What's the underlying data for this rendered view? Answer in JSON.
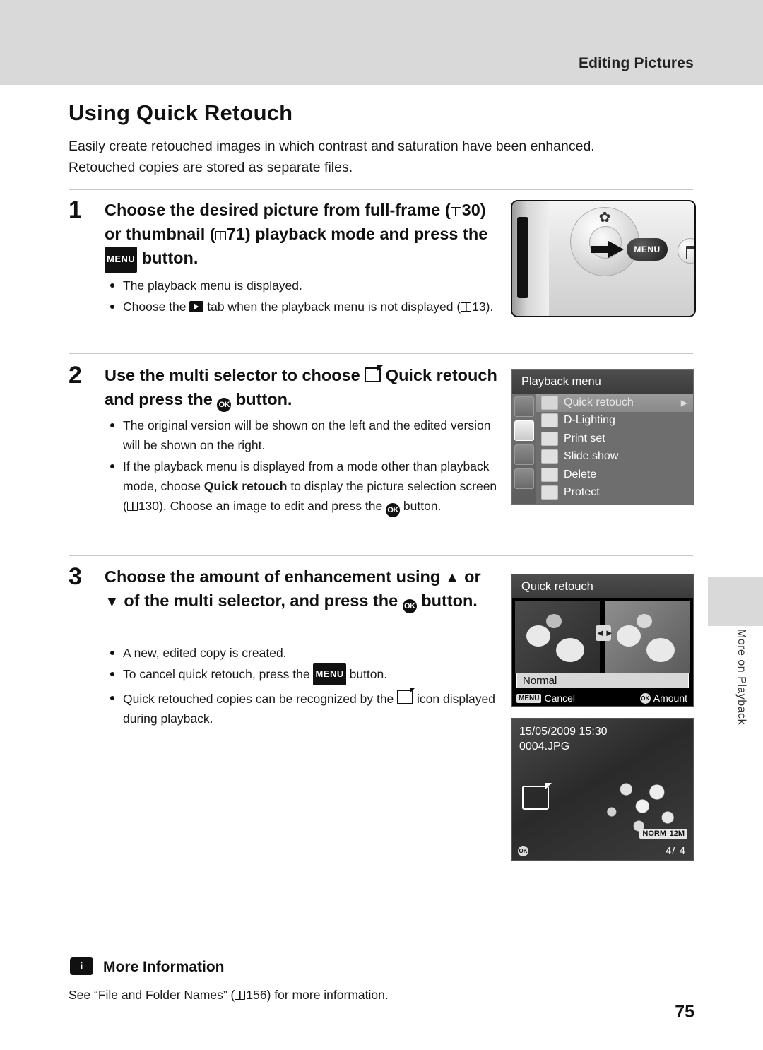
{
  "header": {
    "running_head": "Editing Pictures"
  },
  "title": "Using Quick Retouch",
  "intro": "Easily create retouched images in which contrast and saturation have been enhanced. Retouched copies are stored as separate files.",
  "steps": [
    {
      "number": "1",
      "title_parts": {
        "a": "Choose the desired picture from full-frame (",
        "ref1": "30",
        "b": ") or thumbnail (",
        "ref2": "71",
        "c": ") playback mode and press the ",
        "menu": "MENU",
        "d": " button."
      },
      "bullets": [
        "The playback menu is displayed.",
        "Choose the  tab when the playback menu is not displayed (13)."
      ],
      "bullet2_parts": {
        "a": "Choose the ",
        "b": " tab when the playback menu is not displayed (",
        "ref": "13",
        "c": ")."
      }
    },
    {
      "number": "2",
      "title_parts": {
        "a": "Use the multi selector to choose ",
        "bold1": "Quick retouch",
        "b": " and press the ",
        "ok": "OK",
        "c": " button."
      },
      "bullets": [
        "The original version will be shown on the left and the edited version will be shown on the right.",
        "If the playback menu is displayed from a mode other than playback mode, choose Quick retouch to display the picture selection screen (130). Choose an image to edit and press the k button."
      ],
      "bullet2_parts": {
        "a": "If the playback menu is displayed from a mode other than playback mode, choose ",
        "bold": "Quick retouch",
        "b": " to display the picture selection screen (",
        "ref": "130",
        "c": "). Choose an image to edit and press the ",
        "d": " button."
      }
    },
    {
      "number": "3",
      "title_parts": {
        "a": "Choose the amount of enhancement using ",
        "up": "▲",
        "b": " or ",
        "down": "▼",
        "c": " of the multi selector, and press the ",
        "ok": "OK",
        "d": " button."
      },
      "bullets": [
        "A new, edited copy is created.",
        "To cancel quick retouch, press the MENU button.",
        "Quick retouched copies can be recognized by the icon displayed during playback."
      ],
      "bullet2_parts": {
        "a": "To cancel quick retouch, press the ",
        "menu": "MENU",
        "b": " button."
      },
      "bullet3_parts": {
        "a": "Quick retouched copies can be recognized by the ",
        "b": " icon displayed during playback."
      }
    }
  ],
  "figures": {
    "camera": {
      "menu_label": "MENU",
      "trash_label": "delete-button",
      "flower_label": "macro-icon"
    },
    "playback_menu": {
      "title": "Playback menu",
      "items": [
        {
          "label": "Quick retouch",
          "selected": true,
          "arrow": "▶"
        },
        {
          "label": "D-Lighting",
          "selected": false
        },
        {
          "label": "Print set",
          "selected": false
        },
        {
          "label": "Slide show",
          "selected": false
        },
        {
          "label": "Delete",
          "selected": false
        },
        {
          "label": "Protect",
          "selected": false
        }
      ]
    },
    "quick_retouch": {
      "title": "Quick retouch",
      "amount_label": "Normal",
      "cancel_label": "Cancel",
      "cancel_button": "MENU",
      "amount_button_label": "Amount",
      "ok_button": "OK"
    },
    "playback_photo": {
      "date": "15/05/2009 15:30",
      "filename": "0004.JPG",
      "quality": "NORM",
      "image_size": "12M",
      "frame_counter": "4/    4",
      "ok_glyph": "OK"
    }
  },
  "side_tab": {
    "label": "More on Playback"
  },
  "more_information": {
    "icon_label": "i",
    "heading": "More Information",
    "text_a": "See “File and Folder Names” (",
    "ref": "156",
    "text_b": ") for more information."
  },
  "page_number": "75"
}
